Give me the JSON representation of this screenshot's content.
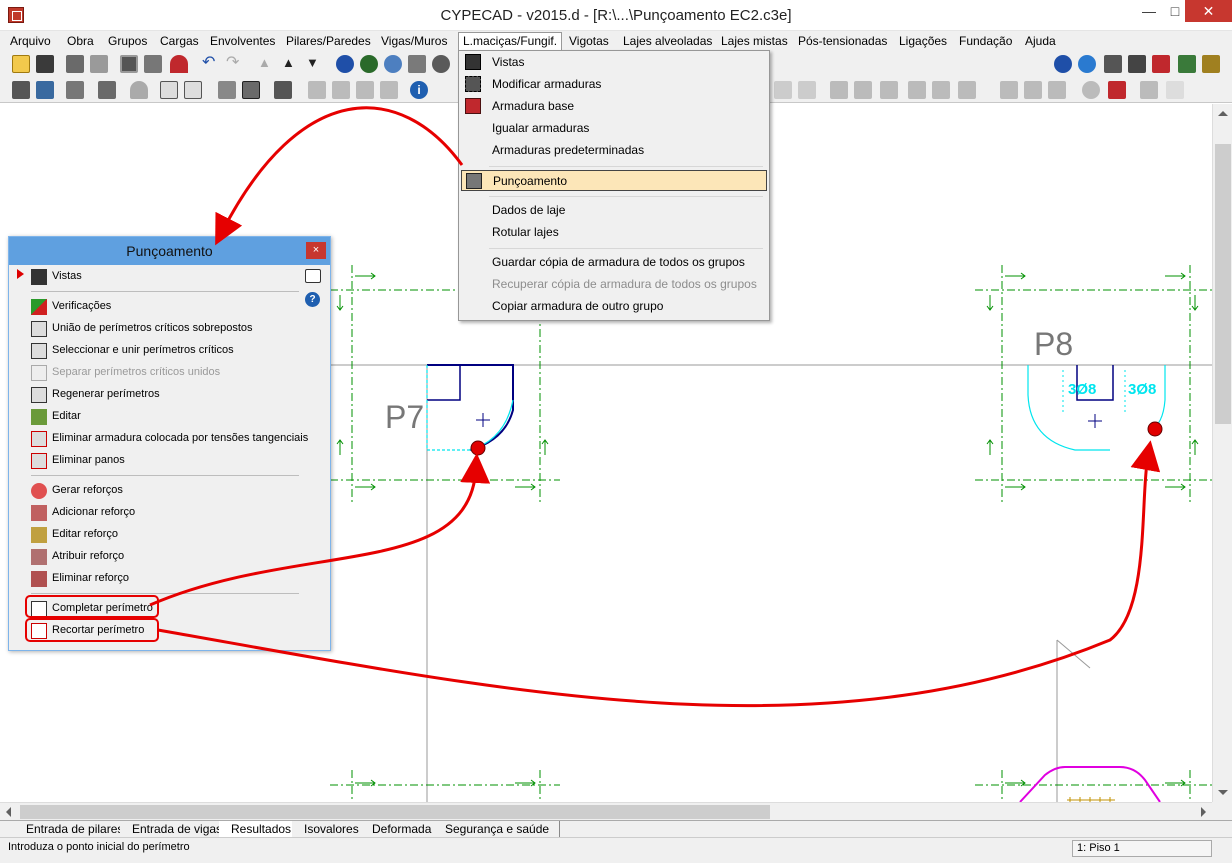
{
  "window": {
    "title": "CYPECAD - v2015.d - [R:\\...\\Punçoamento EC2.c3e]"
  },
  "menubar": [
    {
      "label": "Arquivo"
    },
    {
      "label": "Obra"
    },
    {
      "label": "Grupos"
    },
    {
      "label": "Cargas"
    },
    {
      "label": "Envolventes"
    },
    {
      "label": "Pilares/Paredes"
    },
    {
      "label": "Vigas/Muros"
    },
    {
      "label": "L.maciças/Fungif."
    },
    {
      "label": "Vigotas"
    },
    {
      "label": "Lajes alveoladas"
    },
    {
      "label": "Lajes mistas"
    },
    {
      "label": "Pós-tensionadas"
    },
    {
      "label": "Ligações"
    },
    {
      "label": "Fundação"
    },
    {
      "label": "Ajuda"
    }
  ],
  "dropdown": [
    {
      "label": "Vistas"
    },
    {
      "label": "Modificar armaduras"
    },
    {
      "label": "Armadura base"
    },
    {
      "label": "Igualar armaduras"
    },
    {
      "label": "Armaduras predeterminadas"
    },
    {
      "label": "Punçoamento"
    },
    {
      "label": "Dados de laje"
    },
    {
      "label": "Rotular lajes"
    },
    {
      "label": "Guardar cópia de armadura de todos os grupos"
    },
    {
      "label": "Recuperar cópia de armadura de todos os grupos"
    },
    {
      "label": "Copiar armadura de outro grupo"
    }
  ],
  "panel": {
    "title": "Punçoamento",
    "close": "×",
    "items": [
      {
        "label": "Vistas"
      },
      {
        "label": "Verificações"
      },
      {
        "label": "União de perímetros críticos sobrepostos"
      },
      {
        "label": "Seleccionar e unir perímetros críticos"
      },
      {
        "label": "Separar perímetros críticos unidos"
      },
      {
        "label": "Regenerar perímetros"
      },
      {
        "label": "Editar"
      },
      {
        "label": "Eliminar armadura colocada por tensões tangenciais"
      },
      {
        "label": "Eliminar panos"
      },
      {
        "label": "Gerar reforços"
      },
      {
        "label": "Adicionar reforço"
      },
      {
        "label": "Editar reforço"
      },
      {
        "label": "Atribuir reforço"
      },
      {
        "label": "Eliminar reforço"
      },
      {
        "label": "Completar perímetro"
      },
      {
        "label": "Recortar perímetro"
      }
    ]
  },
  "drawing": {
    "p7": "P7",
    "p8": "P8",
    "bar_left": "3Ø8",
    "bar_right": "3Ø8"
  },
  "tabs": [
    {
      "label": "Entrada de pilares"
    },
    {
      "label": "Entrada de vigas"
    },
    {
      "label": "Resultados"
    },
    {
      "label": "Isovalores"
    },
    {
      "label": "Deformada"
    },
    {
      "label": "Segurança e saúde"
    }
  ],
  "status": {
    "message": "Introduza o ponto inicial do perímetro",
    "floor": "1: Piso 1"
  },
  "colors": {
    "highlight": "#e60000",
    "cyan": "#00e5ee",
    "dash": "#009000",
    "magenta": "#e000e0",
    "navy": "#000080"
  }
}
